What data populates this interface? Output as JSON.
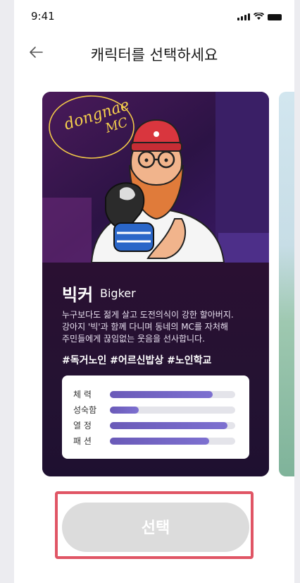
{
  "status_bar": {
    "time": "9:41"
  },
  "header": {
    "title": "캐릭터를 선택하세요"
  },
  "card": {
    "name": "빅커",
    "name_en": "Bigker",
    "description": [
      "누구보다도 젊게 살고 도전의식이 강한 할아버지.",
      "강아지 '빅'과 함께 다니며 동네의 MC를 자처해",
      "주민들에게 끊임없는 웃음을 선사합니다."
    ],
    "tags": "#독거노인 #어르신밥상 #노인학교",
    "neon_sign": [
      "dongnae",
      "MC"
    ],
    "stats": [
      {
        "label": "체   력",
        "level": 0.82
      },
      {
        "label": "성숙함",
        "level": 0.23
      },
      {
        "label": "열   정",
        "level": 0.94
      },
      {
        "label": "패   션",
        "level": 0.79
      }
    ]
  },
  "select_button": {
    "label": "선택"
  },
  "colors": {
    "accent": "#6a5ab8",
    "highlight": "#e05565",
    "button_disabled": "#dcdcdc"
  }
}
